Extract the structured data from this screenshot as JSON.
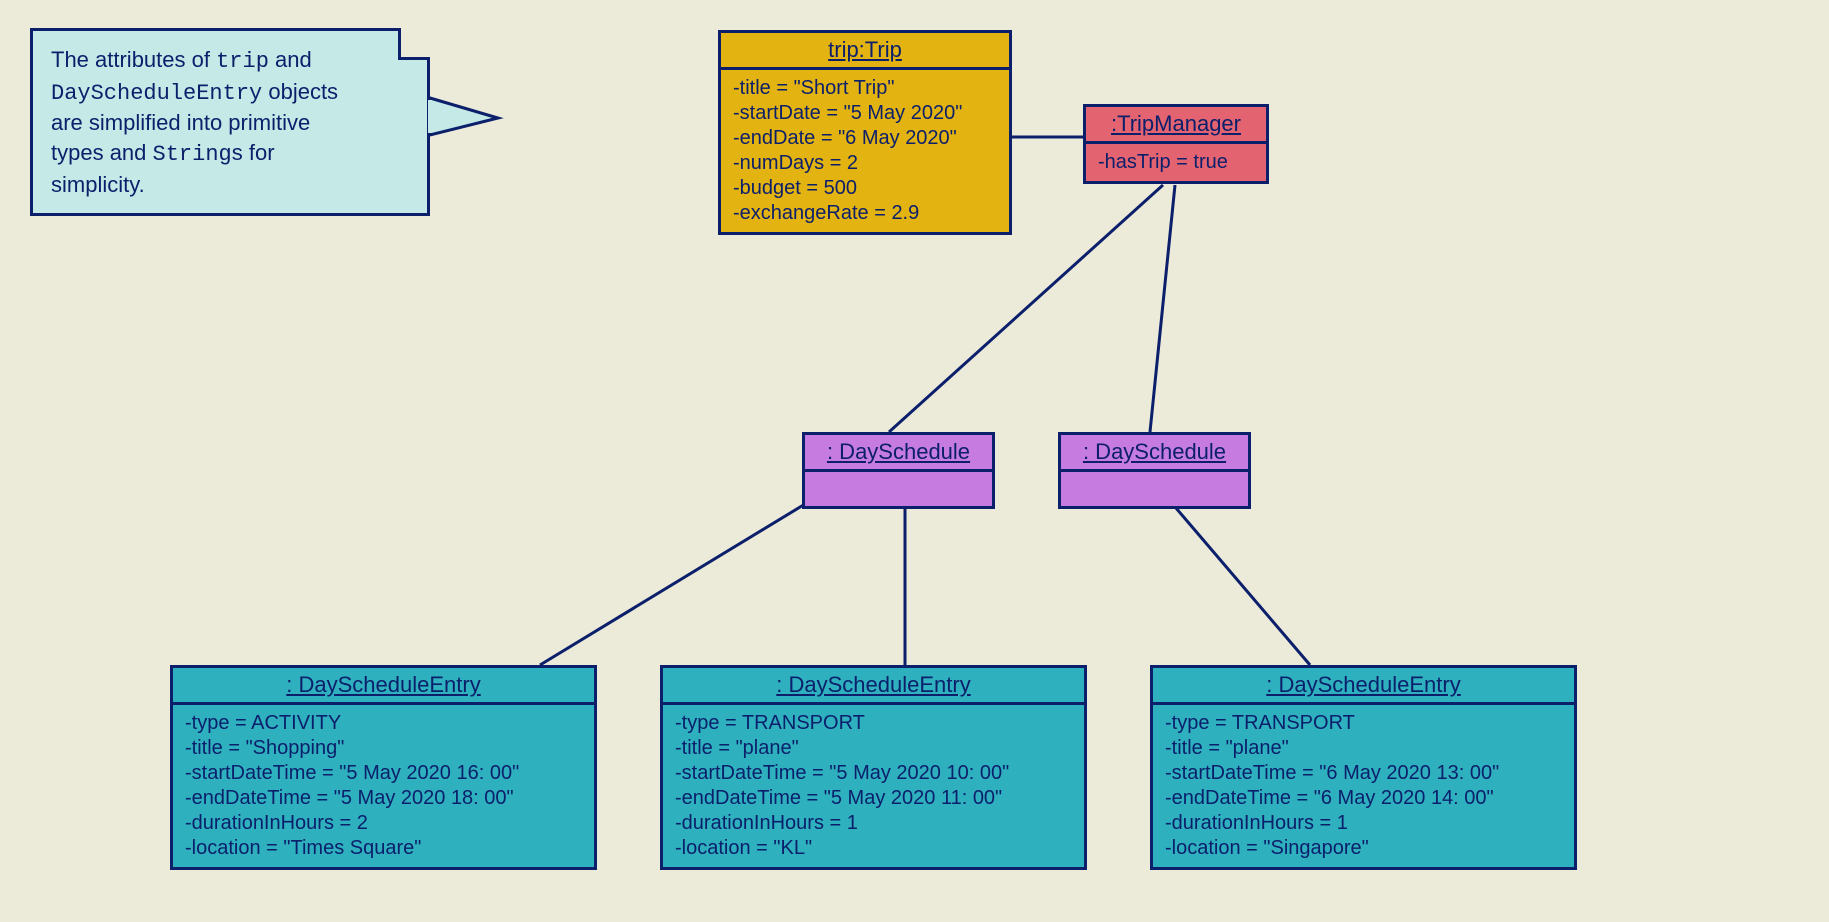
{
  "note": {
    "line1_a": "The attributes of ",
    "line1_b": "trip",
    "line1_c": " and",
    "line2_a": "DayScheduleEntry",
    "line2_b": " objects",
    "line3": "are simplified into primitive",
    "line4_a": "types and ",
    "line4_b": "String",
    "line4_c": "s for",
    "line5": "simplicity."
  },
  "trip": {
    "title": "trip:Trip",
    "attrs": [
      "-title = \"Short Trip\"",
      "-startDate = \"5 May 2020\"",
      "-endDate = \"6 May 2020\"",
      "-numDays = 2",
      "-budget = 500",
      "-exchangeRate = 2.9"
    ]
  },
  "tripManager": {
    "title": ":TripManager",
    "attrs": [
      "-hasTrip = true"
    ]
  },
  "daySchedule1": {
    "title": ": DaySchedule"
  },
  "daySchedule2": {
    "title": ": DaySchedule"
  },
  "entry1": {
    "title": ": DayScheduleEntry",
    "attrs": [
      "-type = ACTIVITY",
      "-title = \"Shopping\"",
      "-startDateTime = \"5 May 2020 16: 00\"",
      "-endDateTime = \"5 May 2020 18: 00\"",
      "-durationInHours = 2",
      "-location = \"Times Square\""
    ]
  },
  "entry2": {
    "title": ": DayScheduleEntry",
    "attrs": [
      "-type = TRANSPORT",
      "-title = \"plane\"",
      "-startDateTime = \"5 May 2020 10: 00\"",
      "-endDateTime = \"5 May 2020 11: 00\"",
      "-durationInHours = 1",
      "-location = \"KL\""
    ]
  },
  "entry3": {
    "title": ": DayScheduleEntry",
    "attrs": [
      "-type = TRANSPORT",
      "-title = \"plane\"",
      "-startDateTime = \"6 May 2020 13: 00\"",
      "-endDateTime = \"6 May 2020 14: 00\"",
      "-durationInHours = 1",
      "-location = \"Singapore\""
    ]
  }
}
